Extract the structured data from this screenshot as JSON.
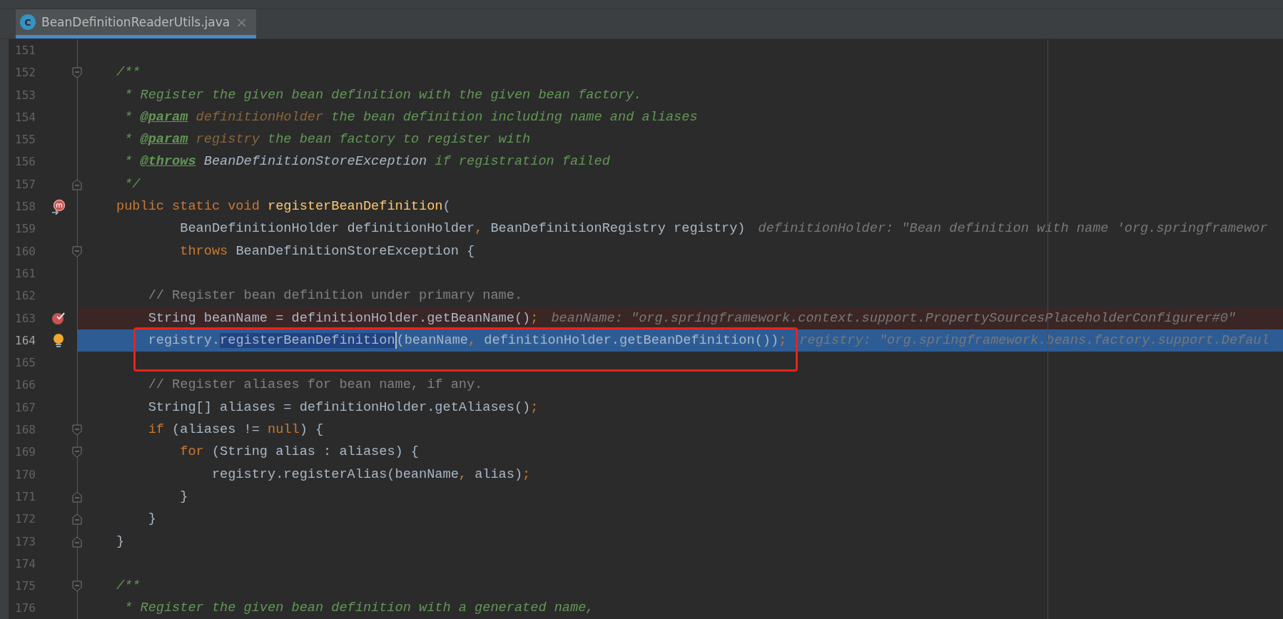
{
  "tabs": [
    {
      "label": "BeanDefinitionReaderUtils.java",
      "icon": "C",
      "close": "×",
      "selected": true
    }
  ],
  "lines": [
    {
      "number": "151"
    },
    {
      "number": "152",
      "fold_start": true,
      "tokens": [
        {
          "kind": "doc",
          "text": "/**"
        }
      ]
    },
    {
      "number": "153",
      "tokens": [
        {
          "kind": "doc",
          "text": " * Register the given bean definition with the given bean factory."
        }
      ]
    },
    {
      "number": "154",
      "tokens": [
        {
          "kind": "doc",
          "text": " * "
        },
        {
          "kind": "doctag",
          "text": "@param"
        },
        {
          "kind": "docparam",
          "text": " definitionHolder"
        },
        {
          "kind": "doc",
          "text": " the bean definition including name and aliases"
        }
      ]
    },
    {
      "number": "155",
      "tokens": [
        {
          "kind": "doc",
          "text": " * "
        },
        {
          "kind": "doctag",
          "text": "@param"
        },
        {
          "kind": "docparam",
          "text": " registry"
        },
        {
          "kind": "doc",
          "text": " the bean factory to register with"
        }
      ]
    },
    {
      "number": "156",
      "tokens": [
        {
          "kind": "doc",
          "text": " * "
        },
        {
          "kind": "doctag",
          "text": "@throws"
        },
        {
          "kind": "doclink",
          "text": " BeanDefinitionStoreException"
        },
        {
          "kind": "doc",
          "text": " if registration failed"
        }
      ]
    },
    {
      "number": "157",
      "fold_end": true,
      "tokens": [
        {
          "kind": "doc",
          "text": " */"
        }
      ]
    },
    {
      "number": "158",
      "gutter_icon": {
        "kind": "override"
      },
      "tokens": [
        {
          "kind": "keyword",
          "text": "public static void "
        },
        {
          "kind": "method",
          "text": "registerBeanDefinition"
        },
        {
          "kind": "plain",
          "text": "("
        }
      ]
    },
    {
      "number": "159",
      "tokens": [
        {
          "kind": "plain",
          "text": "        BeanDefinitionHolder definitionHolder"
        },
        {
          "kind": "keyword",
          "text": ","
        },
        {
          "kind": "plain",
          "text": " BeanDefinitionRegistry registry)"
        },
        {
          "kind": "hint",
          "text": "definitionHolder: \"Bean definition with name 'org.springframewor"
        }
      ]
    },
    {
      "number": "160",
      "fold_start": true,
      "tokens": [
        {
          "kind": "keyword",
          "text": "        throws "
        },
        {
          "kind": "plain",
          "text": "BeanDefinitionStoreException {"
        }
      ]
    },
    {
      "number": "161"
    },
    {
      "number": "162",
      "tokens": [
        {
          "kind": "comment",
          "text": "    // Register bean definition under primary name."
        }
      ]
    },
    {
      "number": "163",
      "breakpoint": true,
      "gutter_icon": {
        "kind": "breakpoint"
      },
      "tokens": [
        {
          "kind": "plain",
          "text": "    String beanName = definitionHolder.getBeanName()"
        },
        {
          "kind": "keyword",
          "text": ";"
        },
        {
          "kind": "hint",
          "text": "beanName: \"org.springframework.context.support.PropertySourcesPlaceholderConfigurer#0\""
        }
      ]
    },
    {
      "number": "164",
      "execution_point": true,
      "gutter_icon": {
        "kind": "bulb"
      },
      "tokens": [
        {
          "kind": "plain",
          "text": "    registry."
        },
        {
          "kind": "selection",
          "text": "registerBeanDefinition",
          "caret": true
        },
        {
          "kind": "plain",
          "text": "(beanName"
        },
        {
          "kind": "keyword",
          "text": ","
        },
        {
          "kind": "plain",
          "text": " definitionHolder.getBeanDefinition())"
        },
        {
          "kind": "keyword",
          "text": ";"
        },
        {
          "kind": "hint",
          "text": "registry: \"org.springframework.beans.factory.support.Defaul"
        }
      ]
    },
    {
      "number": "165"
    },
    {
      "number": "166",
      "tokens": [
        {
          "kind": "comment",
          "text": "    // Register aliases for bean name, if any."
        }
      ]
    },
    {
      "number": "167",
      "tokens": [
        {
          "kind": "plain",
          "text": "    String[] aliases = definitionHolder.getAliases()"
        },
        {
          "kind": "keyword",
          "text": ";"
        }
      ]
    },
    {
      "number": "168",
      "fold_start": true,
      "tokens": [
        {
          "kind": "keyword",
          "text": "    if "
        },
        {
          "kind": "plain",
          "text": "(aliases != "
        },
        {
          "kind": "keyword",
          "text": "null"
        },
        {
          "kind": "plain",
          "text": ") {"
        }
      ]
    },
    {
      "number": "169",
      "fold_start": true,
      "tokens": [
        {
          "kind": "keyword",
          "text": "        for "
        },
        {
          "kind": "plain",
          "text": "(String alias : aliases) {"
        }
      ]
    },
    {
      "number": "170",
      "tokens": [
        {
          "kind": "plain",
          "text": "            registry.registerAlias(beanName"
        },
        {
          "kind": "keyword",
          "text": ","
        },
        {
          "kind": "plain",
          "text": " alias)"
        },
        {
          "kind": "keyword",
          "text": ";"
        }
      ]
    },
    {
      "number": "171",
      "fold_end": true,
      "tokens": [
        {
          "kind": "plain",
          "text": "        }"
        }
      ]
    },
    {
      "number": "172",
      "fold_end": true,
      "tokens": [
        {
          "kind": "plain",
          "text": "    }"
        }
      ]
    },
    {
      "number": "173",
      "fold_end": true,
      "tokens": [
        {
          "kind": "plain",
          "text": "}"
        }
      ]
    },
    {
      "number": "174"
    },
    {
      "number": "175",
      "fold_start": true,
      "tokens": [
        {
          "kind": "doc",
          "text": "/**"
        }
      ]
    },
    {
      "number": "176",
      "tokens": [
        {
          "kind": "doc",
          "text": " * Register the given bean definition with a generated name,"
        }
      ]
    }
  ]
}
